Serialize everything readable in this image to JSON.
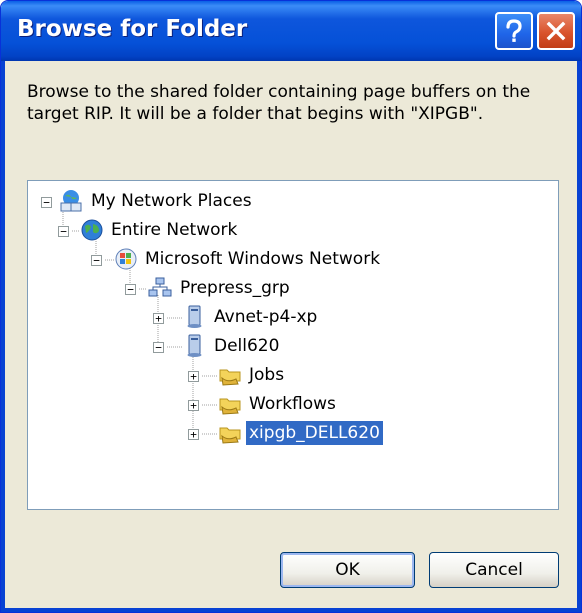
{
  "window": {
    "title": "Browse for Folder",
    "help_label": "?",
    "close_label": "✕"
  },
  "instructions": "Browse to the shared folder containing page buffers on the target RIP. It will be a folder that begins with \"XIPGB\".",
  "tree": {
    "items": [
      {
        "label": "My Network Places",
        "icon": "network-places-icon",
        "expanded": true
      },
      {
        "label": "Entire Network",
        "icon": "globe-icon",
        "expanded": true
      },
      {
        "label": "Microsoft Windows Network",
        "icon": "windows-network-icon",
        "expanded": true
      },
      {
        "label": "Prepress_grp",
        "icon": "workgroup-icon",
        "expanded": true
      },
      {
        "label": "Avnet-p4-xp",
        "icon": "computer-icon",
        "expanded": false
      },
      {
        "label": "Dell620",
        "icon": "computer-icon",
        "expanded": true
      },
      {
        "label": "Jobs",
        "icon": "shared-folder-icon",
        "expanded": false
      },
      {
        "label": "Workflows",
        "icon": "shared-folder-icon",
        "expanded": false
      },
      {
        "label": "xipgb_DELL620",
        "icon": "shared-folder-icon",
        "expanded": false,
        "selected": true
      }
    ],
    "expanded_glyph": "−",
    "collapsed_glyph": "+"
  },
  "buttons": {
    "ok_label": "OK",
    "cancel_label": "Cancel"
  },
  "colors": {
    "titlebar": "#0551d8",
    "selection": "#316ac5",
    "face": "#ece9d8"
  }
}
